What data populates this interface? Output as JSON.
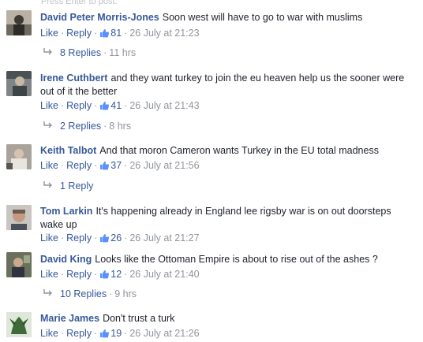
{
  "press_hint": "Press Enter to post.",
  "comments": [
    {
      "author": "David Peter Morris-Jones",
      "text": "Soon west will have to go to war with muslims",
      "like_label": "Like",
      "reply_label": "Reply",
      "likes": "81",
      "timestamp": "26 July at 21:23",
      "replies_label": "8 Replies",
      "replies_time": "11 hrs",
      "avatar_icon": "profile-photo"
    },
    {
      "author": "Irene Cuthbert",
      "text": "and they want turkey to join the eu heaven help us the sooner were out of it the better",
      "like_label": "Like",
      "reply_label": "Reply",
      "likes": "41",
      "timestamp": "26 July at 21:43",
      "replies_label": "2 Replies",
      "replies_time": "8 hrs",
      "avatar_icon": "profile-photo"
    },
    {
      "author": "Keith Talbot",
      "text": "And that moron Cameron wants Turkey in the EU total madness",
      "like_label": "Like",
      "reply_label": "Reply",
      "likes": "37",
      "timestamp": "26 July at 21:56",
      "replies_label": "1 Reply",
      "replies_time": "",
      "avatar_icon": "profile-photo"
    },
    {
      "author": "Tom Larkin",
      "text": "It's happening already in England lee rigsby war is on out doorsteps wake up",
      "like_label": "Like",
      "reply_label": "Reply",
      "likes": "26",
      "timestamp": "26 July at 21:27",
      "replies_label": "",
      "replies_time": "",
      "avatar_icon": "profile-photo"
    },
    {
      "author": "David King",
      "text": "Looks like the Ottoman Empire is about to rise out of the ashes ?",
      "like_label": "Like",
      "reply_label": "Reply",
      "likes": "12",
      "timestamp": "26 July at 21:40",
      "replies_label": "10 Replies",
      "replies_time": "9 hrs",
      "avatar_icon": "profile-photo"
    },
    {
      "author": "Marie James",
      "text": "Don't trust a turk",
      "like_label": "Like",
      "reply_label": "Reply",
      "likes": "19",
      "timestamp": "26 July at 21:26",
      "replies_label": "",
      "replies_time": "",
      "avatar_icon": "profile-photo"
    }
  ],
  "colors": {
    "author": "#365899",
    "link": "#365899",
    "meta": "#90949c",
    "text": "#1d2129"
  }
}
